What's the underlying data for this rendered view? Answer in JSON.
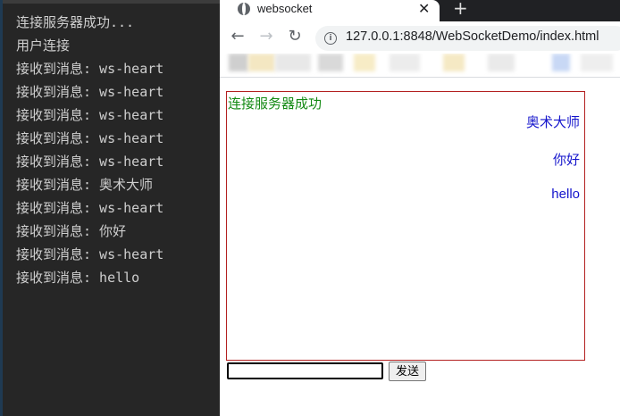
{
  "terminal": {
    "lines": [
      "连接服务器成功...",
      "用户连接",
      "接收到消息: ws-heart",
      "接收到消息: ws-heart",
      "接收到消息: ws-heart",
      "接收到消息: ws-heart",
      "接收到消息: ws-heart",
      "接收到消息: 奥术大师",
      "接收到消息: ws-heart",
      "接收到消息: 你好",
      "接收到消息: ws-heart",
      "接收到消息: hello"
    ]
  },
  "browser": {
    "tab": {
      "title": "websocket",
      "favicon": "globe-icon",
      "close_icon": "close-icon"
    },
    "new_tab_icon": "plus-icon",
    "toolbar": {
      "back_icon": "arrow-left-icon",
      "forward_icon": "arrow-right-icon",
      "reload_icon": "reload-icon",
      "info_icon": "info-icon",
      "url": "127.0.0.1:8848/WebSocketDemo/index.html"
    }
  },
  "page": {
    "status": "连接服务器成功",
    "sent_messages": [
      "奥术大师",
      "你好",
      "hello"
    ],
    "input_value": "",
    "send_label": "发送",
    "colors": {
      "status": "#138a13",
      "sent": "#1515cc",
      "border": "#b32020"
    }
  }
}
